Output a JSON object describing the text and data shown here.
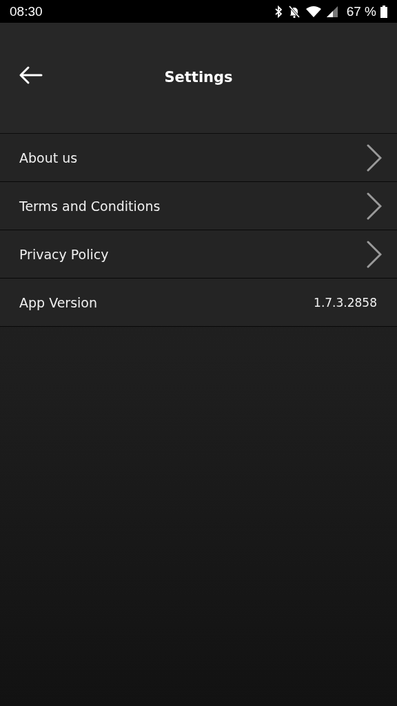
{
  "status_bar": {
    "time": "08:30",
    "battery": "67 %"
  },
  "header": {
    "title": "Settings"
  },
  "items": [
    {
      "kind": "link",
      "label": "About us"
    },
    {
      "kind": "link",
      "label": "Terms and Conditions"
    },
    {
      "kind": "link",
      "label": "Privacy Policy"
    },
    {
      "kind": "value",
      "label": "App Version",
      "value": "1.7.3.2858"
    }
  ]
}
